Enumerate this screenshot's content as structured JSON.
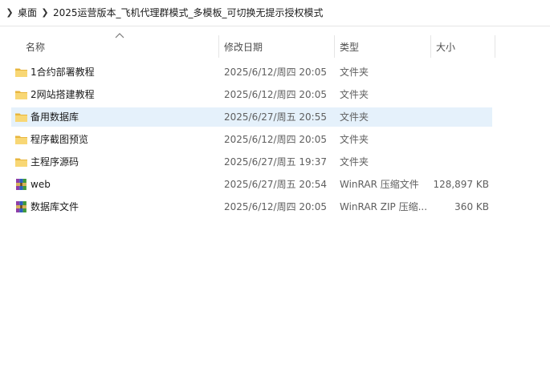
{
  "breadcrumb": {
    "items": [
      "桌面",
      "2025运营版本_飞机代理群模式_多模板_可切换无提示授权模式"
    ]
  },
  "columns": {
    "name": "名称",
    "date": "修改日期",
    "type": "类型",
    "size": "大小"
  },
  "files": [
    {
      "name": "1合约部署教程",
      "date": "2025/6/12/周四 20:05",
      "type": "文件夹",
      "size": "",
      "icon": "folder-icon"
    },
    {
      "name": "2网站搭建教程",
      "date": "2025/6/12/周四 20:05",
      "type": "文件夹",
      "size": "",
      "icon": "folder-icon"
    },
    {
      "name": "备用数据库",
      "date": "2025/6/27/周五 20:55",
      "type": "文件夹",
      "size": "",
      "icon": "folder-icon",
      "selected": true
    },
    {
      "name": "程序截图预览",
      "date": "2025/6/12/周四 20:05",
      "type": "文件夹",
      "size": "",
      "icon": "folder-icon"
    },
    {
      "name": "主程序源码",
      "date": "2025/6/27/周五 19:37",
      "type": "文件夹",
      "size": "",
      "icon": "folder-icon"
    },
    {
      "name": "web",
      "date": "2025/6/27/周五 20:54",
      "type": "WinRAR 压缩文件",
      "size": "128,897 KB",
      "icon": "winrar-archive-icon"
    },
    {
      "name": "数据库文件",
      "date": "2025/6/12/周四 20:05",
      "type": "WinRAR ZIP 压缩...",
      "size": "360 KB",
      "icon": "winrar-zip-icon"
    }
  ],
  "colors": {
    "selected_row": "#e5f1fb",
    "folder": "#f8d775",
    "folder_dark": "#e8b63e"
  }
}
